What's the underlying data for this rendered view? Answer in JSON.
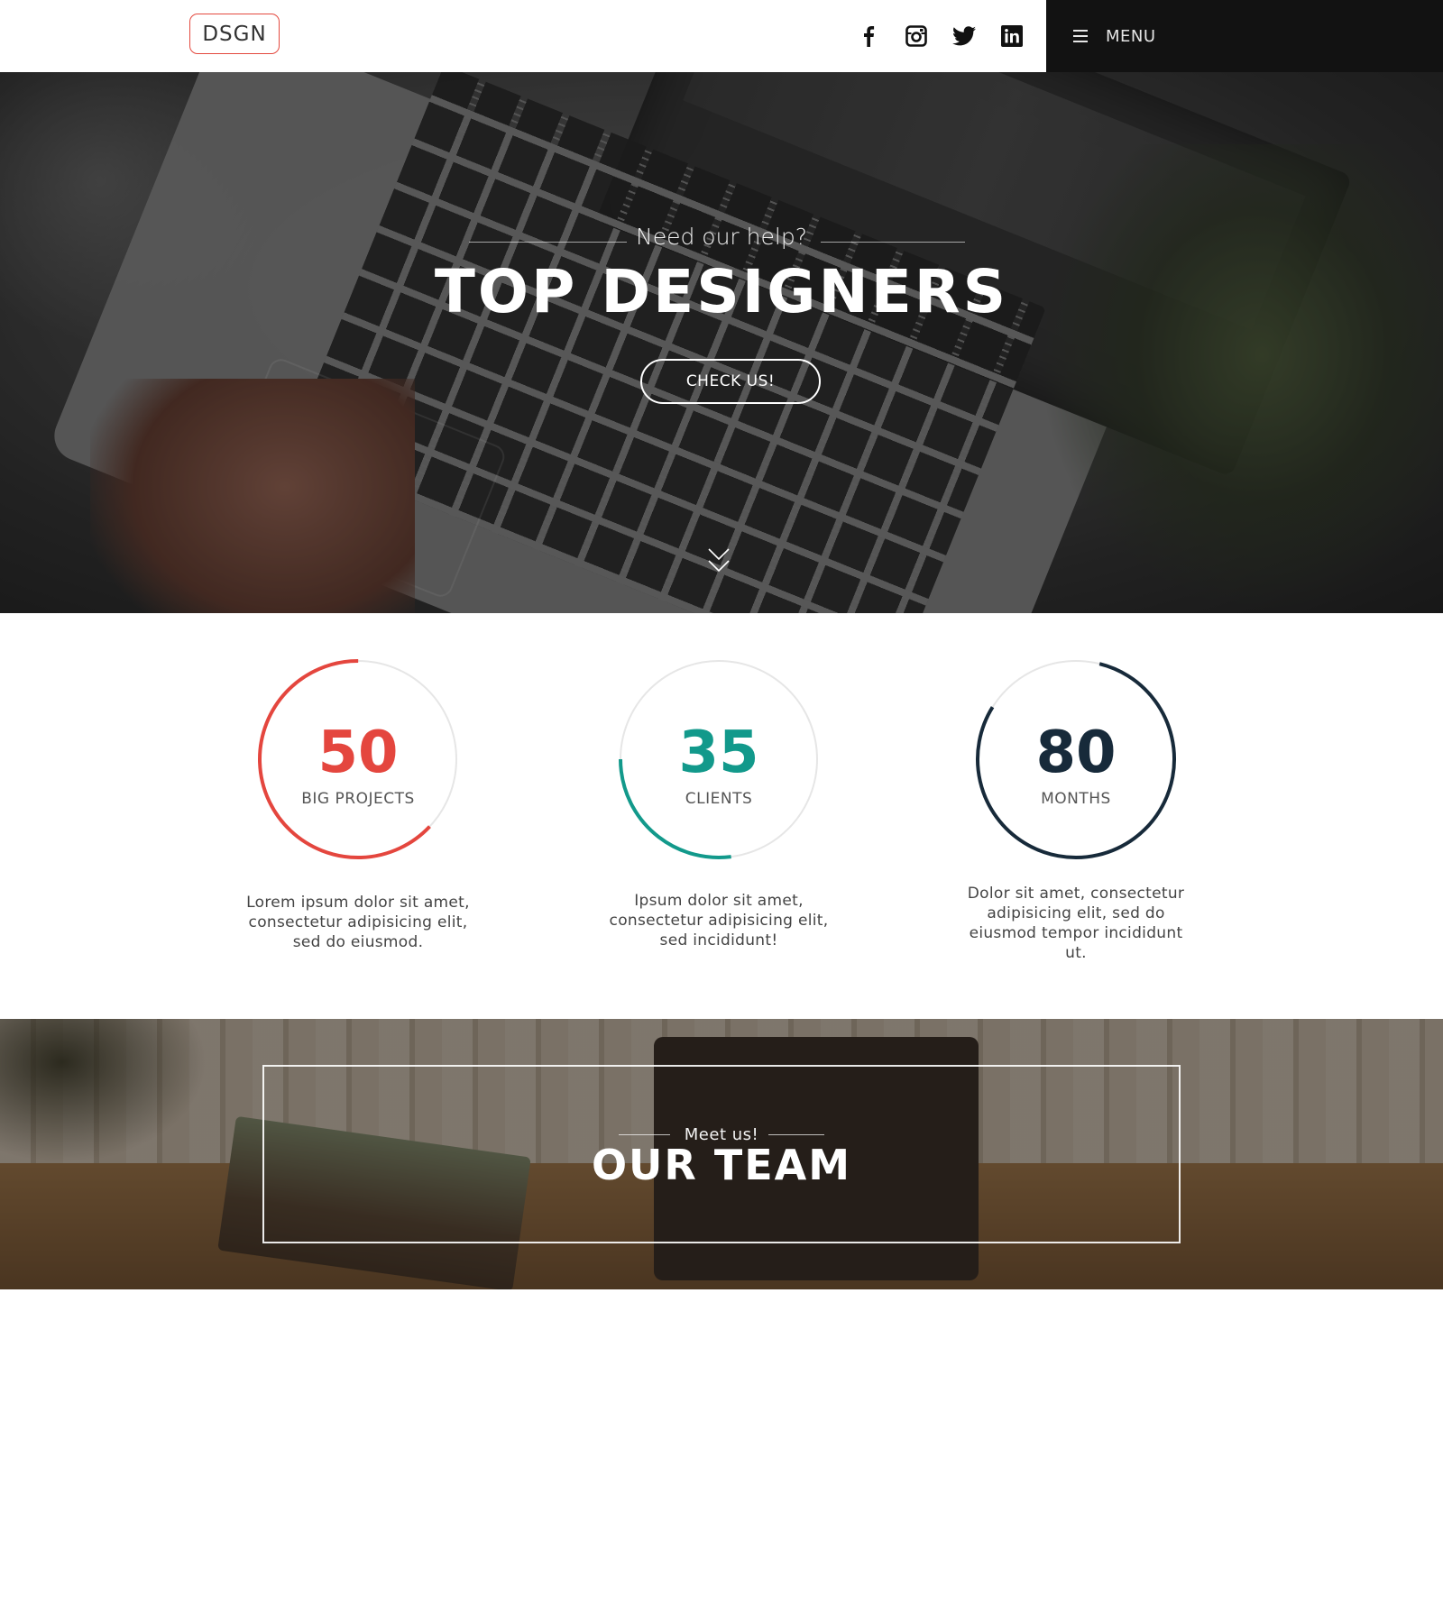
{
  "header": {
    "logo": "DSGN",
    "social_icons": [
      "facebook-icon",
      "instagram-icon",
      "twitter-icon",
      "linkedin-icon"
    ],
    "menu_label": "MENU"
  },
  "hero": {
    "subtitle": "Need our help?",
    "title": "TOP DESIGNERS",
    "button_label": "CHECK US!"
  },
  "stats": [
    {
      "number": "50",
      "label": "BIG PROJECTS",
      "color": "#e4463e",
      "progress": 0.63,
      "description": "Lorem ipsum dolor sit amet, consectetur adipisicing elit, sed do eiusmod."
    },
    {
      "number": "35",
      "label": "CLIENTS",
      "color": "#12998b",
      "progress": 0.27,
      "description": "Ipsum dolor sit amet, consectetur adipisicing elit, sed incididunt!"
    },
    {
      "number": "80",
      "label": "MONTHS",
      "color": "#172a3a",
      "progress": 0.8,
      "description": "Dolor sit amet, consectetur adipisicing elit, sed do eiusmod tempor incididunt ut."
    }
  ],
  "team": {
    "subtitle": "Meet us!",
    "title": "OUR TEAM"
  },
  "colors": {
    "accent_red": "#e4463e",
    "accent_teal": "#12998b",
    "accent_navy": "#172a3a",
    "menu_bg": "#121212"
  }
}
